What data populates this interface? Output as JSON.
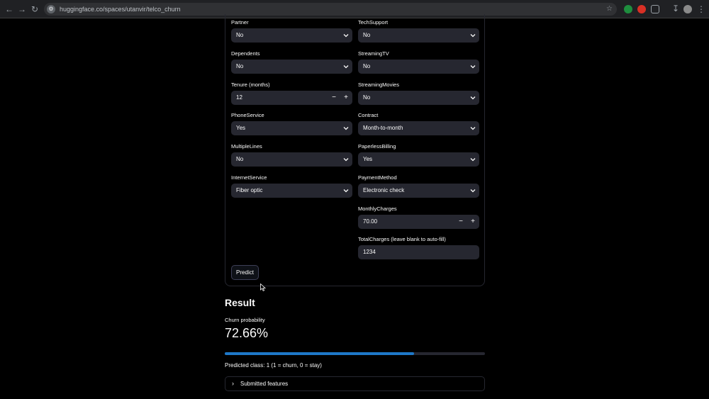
{
  "browser": {
    "url": "huggingface.co/spaces/utanvir/telco_churn",
    "back_icon": "arrow-left-icon",
    "forward_icon": "arrow-right-icon",
    "reload_icon": "reload-icon"
  },
  "form": {
    "left_fields": [
      {
        "label": "Partner",
        "value": "No",
        "type": "select"
      },
      {
        "label": "Dependents",
        "value": "No",
        "type": "select"
      },
      {
        "label": "Tenure (months)",
        "value": "12",
        "type": "number"
      },
      {
        "label": "PhoneService",
        "value": "Yes",
        "type": "select"
      },
      {
        "label": "MultipleLines",
        "value": "No",
        "type": "select"
      },
      {
        "label": "InternetService",
        "value": "Fiber optic",
        "type": "select"
      }
    ],
    "right_fields": [
      {
        "label": "TechSupport",
        "value": "No",
        "type": "select"
      },
      {
        "label": "StreamingTV",
        "value": "No",
        "type": "select"
      },
      {
        "label": "StreamingMovies",
        "value": "No",
        "type": "select"
      },
      {
        "label": "Contract",
        "value": "Month-to-month",
        "type": "select"
      },
      {
        "label": "PaperlessBilling",
        "value": "Yes",
        "type": "select"
      },
      {
        "label": "PaymentMethod",
        "value": "Electronic check",
        "type": "select"
      },
      {
        "label": "MonthlyCharges",
        "value": "70.00",
        "type": "number"
      },
      {
        "label": "TotalCharges (leave blank to auto-fill)",
        "value": "1234",
        "type": "text"
      }
    ],
    "stepper_minus": "−",
    "stepper_plus": "+",
    "predict_label": "Predict"
  },
  "result": {
    "title": "Result",
    "metric_label": "Churn probability",
    "metric_value": "72.66%",
    "progress_fraction": 0.7266,
    "predicted_class": "Predicted class: 1 (1 = churn, 0 = stay)",
    "expander_label": "Submitted features",
    "expander_icon": "chevron-right-icon"
  },
  "colors": {
    "background": "#000000",
    "input_bg": "#262730",
    "progress": "#1e78c8",
    "text": "#fafafa"
  }
}
